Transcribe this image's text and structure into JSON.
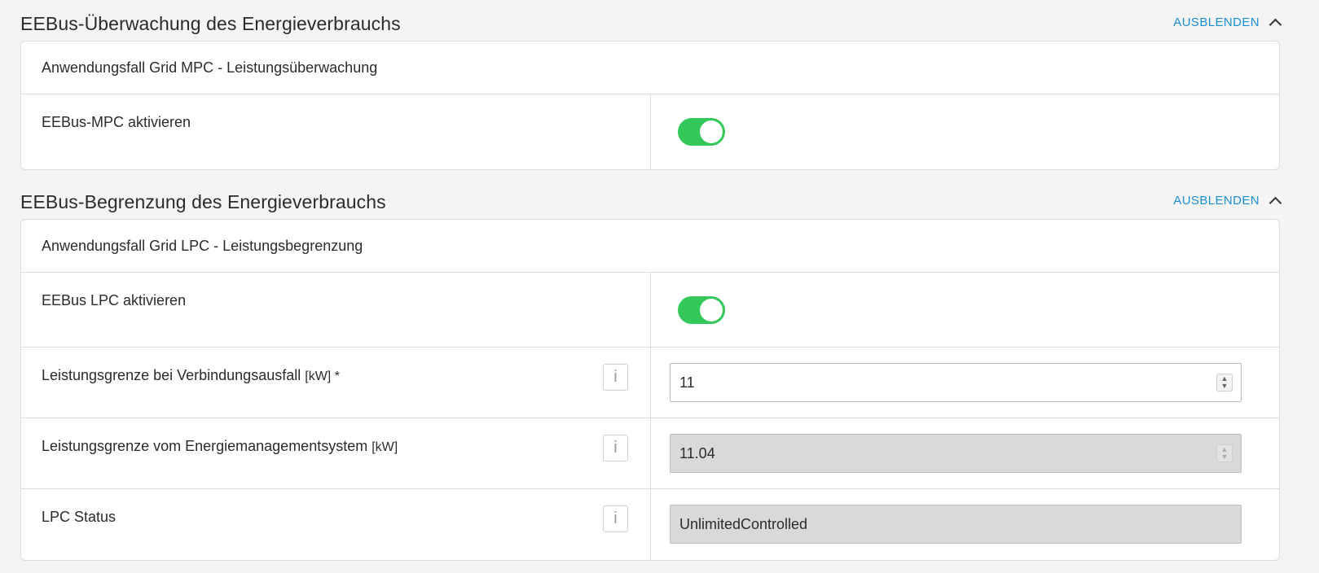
{
  "sections": [
    {
      "title": "EEBus-Überwachung des Energieverbrauchs",
      "collapse_label": "AUSBLENDEN",
      "card_header": "Anwendungsfall Grid MPC - Leistungsüberwachung",
      "rows": [
        {
          "label": "EEBus-MPC aktivieren",
          "toggle_on": true
        }
      ]
    },
    {
      "title": "EEBus-Begrenzung des Energieverbrauchs",
      "collapse_label": "AUSBLENDEN",
      "card_header": "Anwendungsfall Grid LPC - Leistungsbegrenzung",
      "rows": [
        {
          "label": "EEBus LPC aktivieren",
          "toggle_on": true
        },
        {
          "label": "Leistungsgrenze bei Verbindungsausfall",
          "unit": "[kW] *",
          "info": "i",
          "value": "11",
          "disabled": false
        },
        {
          "label": "Leistungsgrenze vom Energiemanagementsystem",
          "unit": "[kW]",
          "info": "i",
          "value": "11.04",
          "disabled": true
        },
        {
          "label": "LPC Status",
          "info": "i",
          "value": "UnlimitedControlled",
          "disabled": true
        }
      ]
    }
  ],
  "colors": {
    "accent_link": "#1a8fd6",
    "toggle_on": "#34c759",
    "disabled_field": "#d9d9d9"
  },
  "icons": {
    "collapse": "chevron-up-icon",
    "info": "info-icon",
    "spinner": "spinner-arrows-icon"
  }
}
